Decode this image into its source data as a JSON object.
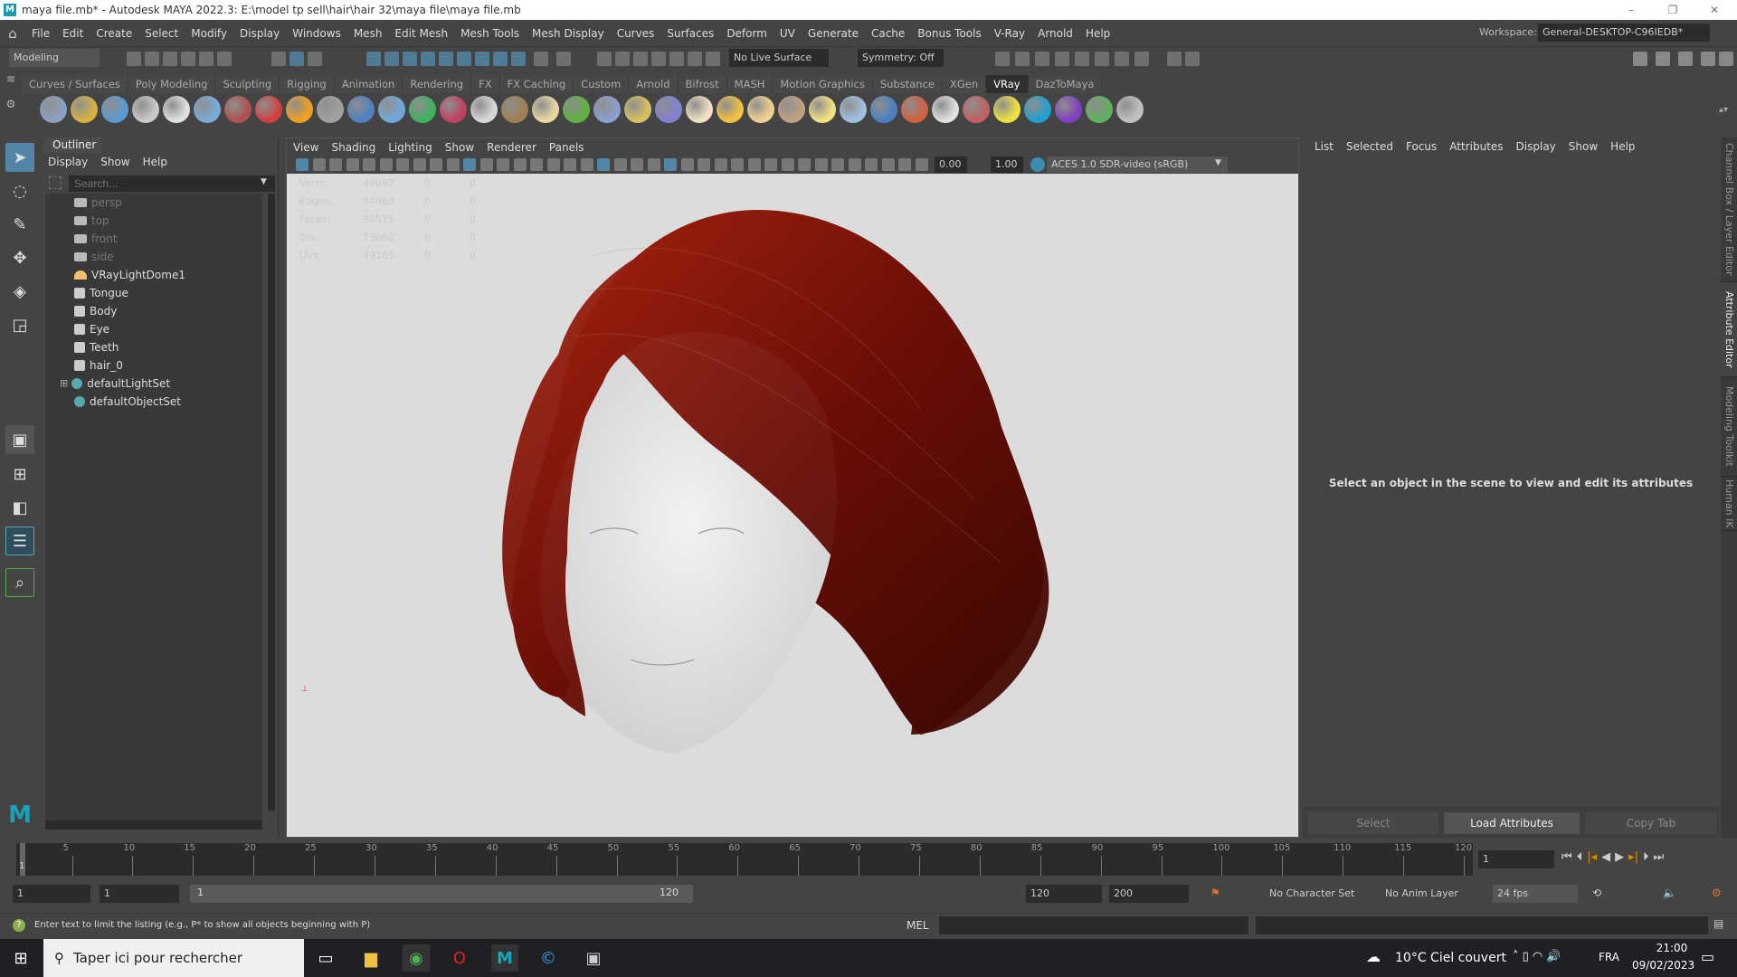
{
  "window": {
    "title": "maya file.mb* - Autodesk MAYA 2022.3: E:\\model tp sell\\hair\\hair 32\\maya file\\maya file.mb",
    "logo": "M"
  },
  "menubar": {
    "items": [
      "File",
      "Edit",
      "Create",
      "Select",
      "Modify",
      "Display",
      "Windows",
      "Mesh",
      "Edit Mesh",
      "Mesh Tools",
      "Mesh Display",
      "Curves",
      "Surfaces",
      "Deform",
      "UV",
      "Generate",
      "Cache",
      "Bonus Tools",
      "V-Ray",
      "Arnold",
      "Help"
    ],
    "workspace_label": "Workspace:",
    "workspace_value": "General-DESKTOP-C96IEDB*"
  },
  "statusline": {
    "mode": "Modeling",
    "live_surface": "No Live Surface",
    "symmetry": "Symmetry: Off"
  },
  "shelf": {
    "tabs": [
      "Curves / Surfaces",
      "Poly Modeling",
      "Sculpting",
      "Rigging",
      "Animation",
      "Rendering",
      "FX",
      "FX Caching",
      "Custom",
      "Arnold",
      "Bifrost",
      "MASH",
      "Motion Graphics",
      "Substance",
      "XGen",
      "VRay",
      "DazToMaya"
    ],
    "active_tab": "VRay",
    "icon_colors": [
      "#8aa0c0",
      "#d8b040",
      "#5a9ad0",
      "#c8c8c8",
      "#e0e0e0",
      "#7aaad8",
      "#b05050",
      "#d04040",
      "#f0a020",
      "#a0a0a0",
      "#5080c0",
      "#6fa8dc",
      "#40b060",
      "#c04060",
      "#d8d8d8",
      "#a08050",
      "#e8d8a0",
      "#60b040",
      "#8aa0d0",
      "#d8c060",
      "#8080d0",
      "#f0e0c0",
      "#f0c040",
      "#f0d090",
      "#c0a080",
      "#f0e080",
      "#a0c0e0",
      "#4a80c0",
      "#d06040",
      "#e0e0e0",
      "#c06060",
      "#f0e040",
      "#20a0d0",
      "#8040c0",
      "#60b060",
      "#c0c0c0"
    ]
  },
  "outliner": {
    "title": "Outliner",
    "menu": [
      "Display",
      "Show",
      "Help"
    ],
    "search_placeholder": "Search...",
    "items": [
      {
        "label": "persp",
        "type": "camera",
        "dim": true
      },
      {
        "label": "top",
        "type": "camera",
        "dim": true
      },
      {
        "label": "front",
        "type": "camera",
        "dim": true
      },
      {
        "label": "side",
        "type": "camera",
        "dim": true
      },
      {
        "label": "VRayLightDome1",
        "type": "light",
        "dim": false
      },
      {
        "label": "Tongue",
        "type": "mesh",
        "dim": false
      },
      {
        "label": "Body",
        "type": "mesh",
        "dim": false
      },
      {
        "label": "Eye",
        "type": "mesh",
        "dim": false
      },
      {
        "label": "Teeth",
        "type": "mesh",
        "dim": false
      },
      {
        "label": "hair_0",
        "type": "mesh",
        "dim": false
      },
      {
        "label": "defaultLightSet",
        "type": "set",
        "dim": false,
        "expandable": true
      },
      {
        "label": "defaultObjectSet",
        "type": "set",
        "dim": false
      }
    ]
  },
  "viewport": {
    "menu": [
      "View",
      "Shading",
      "Lighting",
      "Show",
      "Renderer",
      "Panels"
    ],
    "exposure": "0.00",
    "gamma": "1.00",
    "color_space": "ACES 1.0 SDR-video (sRGB)",
    "hud": [
      {
        "label": "Verts:",
        "v": "49667",
        "a": "0",
        "b": "0"
      },
      {
        "label": "Edges:",
        "v": "84963",
        "a": "0",
        "b": "0"
      },
      {
        "label": "Faces:",
        "v": "36525",
        "a": "0",
        "b": "0"
      },
      {
        "label": "Tris:",
        "v": "73062",
        "a": "0",
        "b": "0"
      },
      {
        "label": "UVs:",
        "v": "49165",
        "a": "0",
        "b": "0"
      }
    ],
    "hair_color": "#8a1a0c"
  },
  "attribute_editor": {
    "menu": [
      "List",
      "Selected",
      "Focus",
      "Attributes",
      "Display",
      "Show",
      "Help"
    ],
    "message": "Select an object in the scene to view and edit its attributes",
    "buttons": {
      "select": "Select",
      "load": "Load Attributes",
      "copy": "Copy Tab"
    },
    "side_tabs": [
      "Channel Box / Layer Editor",
      "Attribute Editor",
      "Modeling Toolkit",
      "Human IK"
    ]
  },
  "timeline": {
    "ticks": [
      5,
      10,
      15,
      20,
      25,
      30,
      35,
      40,
      45,
      50,
      55,
      60,
      65,
      70,
      75,
      80,
      85,
      90,
      95,
      100,
      105,
      110,
      115,
      120
    ],
    "current_frame": "1",
    "start_marker": "1"
  },
  "range": {
    "start": "1",
    "anim_start": "1",
    "slider_start": "1",
    "slider_end": "120",
    "end": "120",
    "anim_end": "200",
    "character_set": "No Character Set",
    "anim_layer": "No Anim Layer",
    "fps": "24 fps"
  },
  "helpline": {
    "text": "Enter text to limit the listing (e.g., P* to show all objects beginning with P)",
    "mel": "MEL"
  },
  "taskbar": {
    "search": "Taper ici pour rechercher",
    "weather": "10°C  Ciel couvert",
    "lang": "FRA",
    "time": "21:00",
    "date": "09/02/2023"
  }
}
